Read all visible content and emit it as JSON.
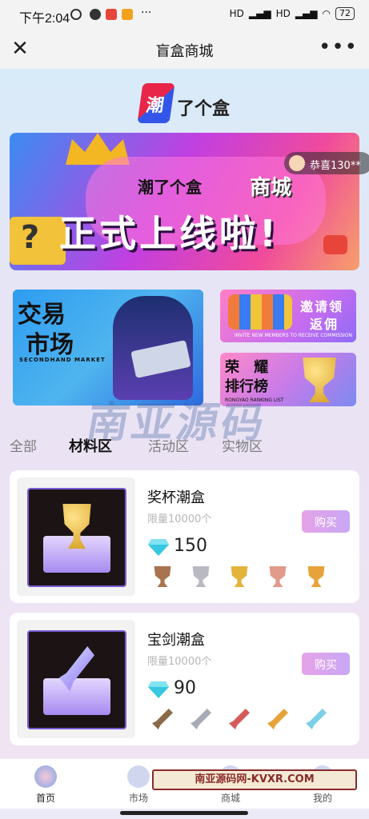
{
  "status_bar": {
    "time": "下午2:04",
    "signal": "HD",
    "battery": "72"
  },
  "titlebar": {
    "title": "盲盒商城",
    "close_label": "✕",
    "more_label": "•••"
  },
  "logo": {
    "mark": "潮",
    "text": "了个盒"
  },
  "banner": {
    "brand": "潮了个盒",
    "mall": "商城",
    "headline": "正式上线啦!"
  },
  "notice": {
    "text": "恭喜130**"
  },
  "promos": {
    "market": {
      "title1": "交易",
      "title2": "市场",
      "caption": "SECONDHAND MARKET"
    },
    "invite": {
      "line1": "邀请领",
      "line2": "返佣",
      "caption": "INVITE NEW MEMBERS TO RECEIVE COMMISSION"
    },
    "rank": {
      "line1": "荣 耀",
      "line2": "排行榜",
      "caption": "RONGYAO RANKING LIST"
    }
  },
  "watermark": {
    "text": "南亚源码"
  },
  "tabs": [
    {
      "label": "全部",
      "active": false
    },
    {
      "label": "材料区",
      "active": true
    },
    {
      "label": "活动区",
      "active": false
    },
    {
      "label": "实物区",
      "active": false
    }
  ],
  "products": [
    {
      "name": "奖杯潮盒",
      "limit": "限量10000个",
      "price": "150",
      "buy_label": "购买",
      "item_type": "trophy",
      "mini_items": [
        "bronze-trophy-icon",
        "silver-trophy-icon",
        "gold-trophy-icon",
        "rose-trophy-icon",
        "rainbow-trophy-icon"
      ],
      "mini_colors": [
        "#a9734f",
        "#b9b9c2",
        "#e3b33a",
        "#e29a8a",
        "#e8a23a"
      ]
    },
    {
      "name": "宝剑潮盒",
      "limit": "限量10000个",
      "price": "90",
      "buy_label": "购买",
      "item_type": "sword",
      "mini_items": [
        "bronze-sword-icon",
        "silver-sword-icon",
        "ruby-sword-icon",
        "gold-sword-icon",
        "crystal-sword-icon"
      ],
      "mini_colors": [
        "#8a6a48",
        "#a8aab5",
        "#d65a5a",
        "#e6a33a",
        "#7ad0e8"
      ]
    }
  ],
  "nav": [
    {
      "label": "首页",
      "icon": "home-icon",
      "active": true
    },
    {
      "label": "市场",
      "icon": "market-icon",
      "active": false
    },
    {
      "label": "商城",
      "icon": "mall-icon",
      "active": false
    },
    {
      "label": "我的",
      "icon": "profile-icon",
      "active": false
    }
  ],
  "ad": {
    "text": "南亚源码网-KVXR.COM"
  },
  "colors": {
    "accent": "#c9a7f5",
    "gem": "#38c7e0"
  }
}
